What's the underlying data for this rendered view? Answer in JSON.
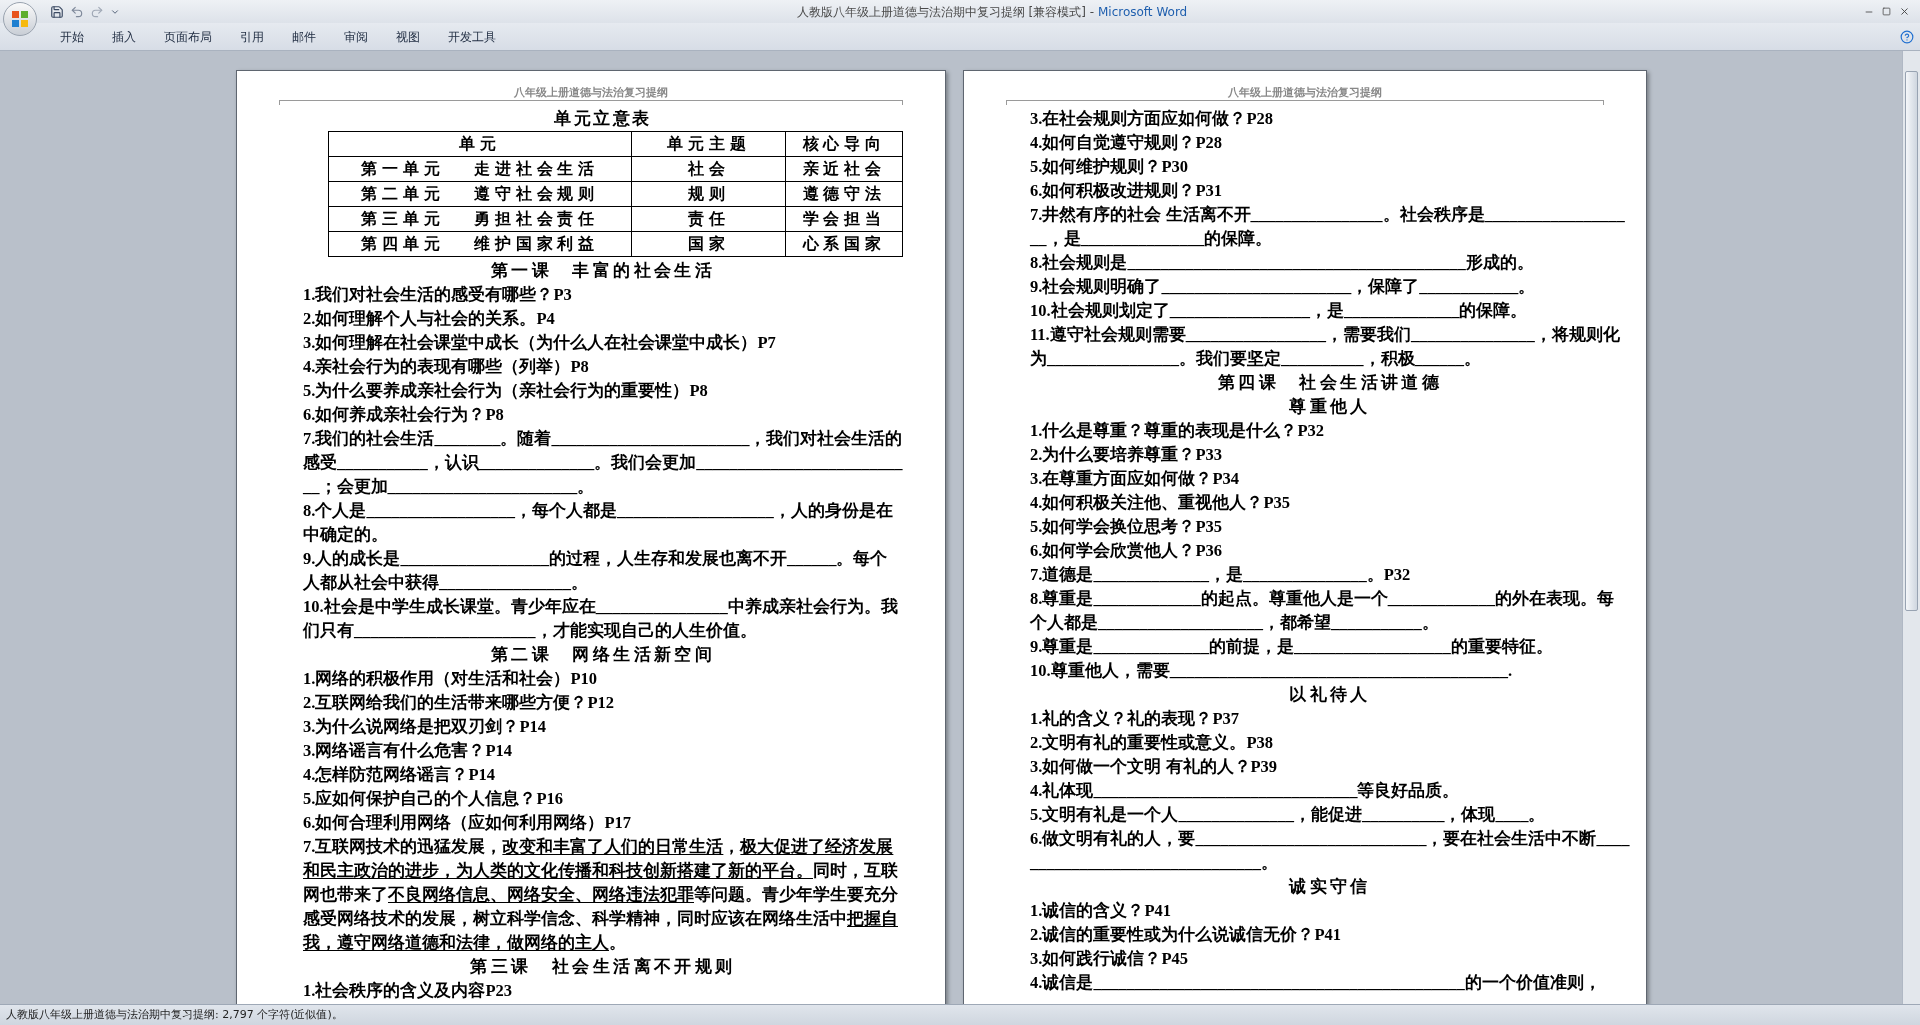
{
  "window": {
    "document": "人教版八年级上册道德与法治期中复习提纲 [兼容模式]",
    "separator": "-",
    "app": "Microsoft Word"
  },
  "ribbon_tabs": [
    {
      "label": "开始"
    },
    {
      "label": "插入"
    },
    {
      "label": "页面布局"
    },
    {
      "label": "引用"
    },
    {
      "label": "邮件"
    },
    {
      "label": "审阅"
    },
    {
      "label": "视图"
    },
    {
      "label": "开发工具"
    }
  ],
  "pages": [
    {
      "header": "八年级上册道德与法治复习提纲",
      "blocks": [
        {
          "kind": "table_title",
          "text": "单元立意表"
        },
        {
          "kind": "table",
          "columns": [
            "单元",
            "单元主题",
            "核心导向"
          ],
          "rows": [
            [
              "第一单元　 走进社会生活",
              "社会",
              "亲近社会"
            ],
            [
              "第二单元　 遵守社会规则",
              "规则",
              "遵德守法"
            ],
            [
              "第三单元　 勇担社会责任",
              "责任",
              "学会担当"
            ],
            [
              "第四单元　 维护国家利益",
              "国家",
              "心系国家"
            ]
          ]
        },
        {
          "kind": "heading",
          "text": "第一课　丰富的社会生活"
        },
        {
          "kind": "item",
          "text": "1.我们对社会生活的感受有哪些？P3"
        },
        {
          "kind": "item",
          "text": "2.如何理解个人与社会的关系。P4"
        },
        {
          "kind": "item",
          "text": "3.如何理解在社会课堂中成长（为什么人在社会课堂中成长）P7"
        },
        {
          "kind": "item",
          "text": "4.亲社会行为的表现有哪些（列举）P8"
        },
        {
          "kind": "item",
          "text": "5.为什么要养成亲社会行为（亲社会行为的重要性）P8"
        },
        {
          "kind": "item",
          "text": "6.如何养成亲社会行为？P8"
        },
        {
          "kind": "item",
          "text": "7.我们的社会生活________。随着________________________，我们对社会生活的感受___________，认识______________。我们会更加___________________________；会更加_______________________。"
        },
        {
          "kind": "item",
          "text": "8.个人是__________________，每个人都是___________________，人的身份是在中确定的。"
        },
        {
          "kind": "item",
          "text": "9.人的成长是__________________的过程，人生存和发展也离不开______。每个人都从社会中获得________________。"
        },
        {
          "kind": "item",
          "text": "10.社会是中学生成长课堂。青少年应在________________中养成亲社会行为。我们只有______________________，才能实现自己的人生价值。"
        },
        {
          "kind": "heading",
          "text": "第二课　网络生活新空间"
        },
        {
          "kind": "item",
          "text": "1.网络的积极作用（对生活和社会）P10"
        },
        {
          "kind": "item",
          "text": "2.互联网给我们的生活带来哪些方便？P12"
        },
        {
          "kind": "item",
          "text": "3.为什么说网络是把双刃剑？P14"
        },
        {
          "kind": "item",
          "text": "3.网络谣言有什么危害？P14"
        },
        {
          "kind": "item",
          "text": "4.怎样防范网络谣言？P14"
        },
        {
          "kind": "item",
          "text": "5.应如何保护自己的个人信息？P16"
        },
        {
          "kind": "item",
          "text": "6.如何合理利用网络（应如何利用网络）P17"
        },
        {
          "kind": "rich_item",
          "segments": [
            {
              "text": "7.互联网技术的迅猛发展，",
              "underlined": false
            },
            {
              "text": "改变和丰富了人们的日常生活",
              "underlined": true
            },
            {
              "text": "，",
              "underlined": false
            },
            {
              "text": "极大促进了经济发展和民主政治的进步，为人类的文化传播和科技创新搭建了新的平台。",
              "underlined": true
            },
            {
              "text": "同时，互联网也带来了",
              "underlined": false
            },
            {
              "text": "不良网络信息、网络安全、网络违法犯罪",
              "underlined": true
            },
            {
              "text": "等问题。青少年学生要充分感受网络技术的发展，树立科学信念、科学精神，同时应该在网络生活中",
              "underlined": false
            },
            {
              "text": "把握自我，遵守网络道德和法律，做网络的主人",
              "underlined": true
            },
            {
              "text": "。",
              "underlined": false
            }
          ]
        },
        {
          "kind": "heading",
          "text": "第三课　社会生活离不开规则"
        },
        {
          "kind": "item",
          "text": "1.社会秩序的含义及内容P23"
        }
      ]
    },
    {
      "header": "八年级上册道德与法治复习提纲",
      "blocks": [
        {
          "kind": "item",
          "text": "3.在社会规则方面应如何做？P28"
        },
        {
          "kind": "item",
          "text": "4.如何自觉遵守规则？P28"
        },
        {
          "kind": "item",
          "text": "5.如何维护规则？P30"
        },
        {
          "kind": "item",
          "text": "6.如何积极改进规则？P31"
        },
        {
          "kind": "item",
          "text": "7.井然有序的社会 生活离不开________________。社会秩序是___________________，是_______________的保障。"
        },
        {
          "kind": "item",
          "text": "8.社会规则是_________________________________________形成的。"
        },
        {
          "kind": "item",
          "text": "9.社会规则明确了_______________________，保障了____________。"
        },
        {
          "kind": "item",
          "text": "10.社会规则划定了_________________，是______________的保障。"
        },
        {
          "kind": "item",
          "text": "11.遵守社会规则需要_________________，需要我们_______________，将规则化为________________。我们要坚定__________，积极______。"
        },
        {
          "kind": "heading",
          "text": "第四课　社会生活讲道德"
        },
        {
          "kind": "heading",
          "text": "尊重他人"
        },
        {
          "kind": "item",
          "text": "1.什么是尊重？尊重的表现是什么？P32"
        },
        {
          "kind": "item",
          "text": "2.为什么要培养尊重？P33"
        },
        {
          "kind": "item",
          "text": "3.在尊重方面应如何做？P34"
        },
        {
          "kind": "item",
          "text": "4.如何积极关注他、重视他人？P35"
        },
        {
          "kind": "item",
          "text": "5.如何学会换位思考？P35"
        },
        {
          "kind": "item",
          "text": "6.如何学会欣赏他人？P36"
        },
        {
          "kind": "item",
          "text": "7.道德是______________，是_______________。P32"
        },
        {
          "kind": "item",
          "text": "8.尊重是_____________的起点。尊重他人是一个_____________的外在表现。每个人都是____________________，都希望___________。"
        },
        {
          "kind": "item",
          "text": "9.尊重是______________的前提，是___________________的重要特征。"
        },
        {
          "kind": "item",
          "text": "10.尊重他人，需要_________________________________________."
        },
        {
          "kind": "heading",
          "text": "以礼待人"
        },
        {
          "kind": "item",
          "text": "1.礼的含义？礼的表现？P37"
        },
        {
          "kind": "item",
          "text": "2.文明有礼的重要性或意义。P38"
        },
        {
          "kind": "item",
          "text": "3.如何做一个文明 有礼的人？P39"
        },
        {
          "kind": "item",
          "text": "4.礼体现________________________________等良好品质。"
        },
        {
          "kind": "item",
          "text": "5.文明有礼是一个人______________，能促进__________，体现____。"
        },
        {
          "kind": "item",
          "text": "6.做文明有礼的人，要____________________________，要在社会生活中不断________________________________。"
        },
        {
          "kind": "heading",
          "text": "诚实守信"
        },
        {
          "kind": "item",
          "text": "1.诚信的含义？P41"
        },
        {
          "kind": "item",
          "text": "2.诚信的重要性或为什么说诚信无价？P41"
        },
        {
          "kind": "item",
          "text": "3.如何践行诚信？P45"
        },
        {
          "kind": "item",
          "text": "4.诚信是_____________________________________________的一个价值准则，"
        }
      ]
    }
  ],
  "status_bar": {
    "text": "人教版八年级上册道德与法治期中复习提纲: 2,797 个字符(近似值)。"
  }
}
